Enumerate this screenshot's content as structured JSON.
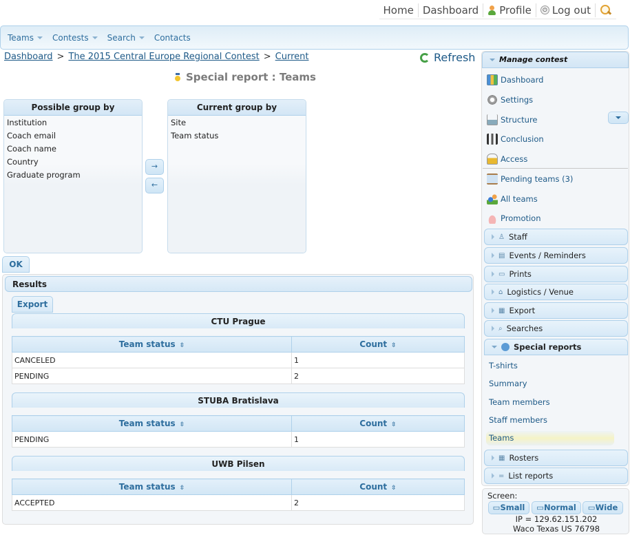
{
  "topbar": {
    "home": "Home",
    "dashboard": "Dashboard",
    "profile": "Profile",
    "logout": "Log out",
    "icons": [
      "user-icon",
      "power-icon",
      "search-icon"
    ]
  },
  "menu": [
    {
      "label": "Teams",
      "has_dropdown": true
    },
    {
      "label": "Contests",
      "has_dropdown": true
    },
    {
      "label": "Search",
      "has_dropdown": true
    },
    {
      "label": "Contacts",
      "has_dropdown": false
    }
  ],
  "breadcrumb": {
    "items": [
      "Dashboard",
      "The 2015 Central Europe Regional Contest",
      "Current"
    ],
    "separator": ">"
  },
  "refresh": "Refresh",
  "page_title": "Special report : Teams",
  "group_by": {
    "possible_title": "Possible group by",
    "possible": [
      "Institution",
      "Coach email",
      "Coach name",
      "Country",
      "Graduate program"
    ],
    "current_title": "Current group by",
    "current": [
      "Site",
      "Team status"
    ],
    "move_right": "→",
    "move_left": "←",
    "ok": "OK"
  },
  "results": {
    "title": "Results",
    "export": "Export",
    "col_status": "Team status",
    "col_count": "Count",
    "sort_glyph": "⇳",
    "groups": [
      {
        "name": "CTU Prague",
        "rows": [
          {
            "status": "CANCELED",
            "count": "1"
          },
          {
            "status": "PENDING",
            "count": "2"
          }
        ]
      },
      {
        "name": "STUBA Bratislava",
        "rows": [
          {
            "status": "PENDING",
            "count": "1"
          }
        ]
      },
      {
        "name": "UWB Pilsen",
        "rows": [
          {
            "status": "ACCEPTED",
            "count": "2"
          }
        ]
      }
    ]
  },
  "sidebar": {
    "title": "Manage contest",
    "items": [
      {
        "label": "Dashboard",
        "icon": "dashboard-icon"
      },
      {
        "label": "Settings",
        "icon": "gear-icon"
      },
      {
        "label": "Structure",
        "icon": "structure-icon"
      },
      {
        "label": "Conclusion",
        "icon": "conclusion-icon"
      },
      {
        "label": "Access",
        "icon": "lock-icon"
      },
      {
        "label": "Pending teams (3)",
        "icon": "hourglass-icon"
      },
      {
        "label": "All teams",
        "icon": "users-icon"
      },
      {
        "label": "Promotion",
        "icon": "thumbs-up-icon"
      }
    ],
    "sections": [
      {
        "label": "Staff",
        "icon": "staff-icon",
        "glyph": "♙"
      },
      {
        "label": "Events / Reminders",
        "icon": "comment-icon",
        "glyph": "▤"
      },
      {
        "label": "Prints",
        "icon": "print-icon",
        "glyph": "▭"
      },
      {
        "label": "Logistics / Venue",
        "icon": "venue-icon",
        "glyph": "⌂"
      },
      {
        "label": "Export",
        "icon": "export-icon",
        "glyph": "▦"
      },
      {
        "label": "Searches",
        "icon": "search-icon",
        "glyph": "⌕"
      }
    ],
    "special_reports": {
      "label": "Special reports",
      "items": [
        "T-shirts",
        "Summary",
        "Team members",
        "Staff members",
        "Teams"
      ],
      "selected": "Teams"
    },
    "bottom_sections": [
      {
        "label": "Rosters",
        "icon": "calendar-icon",
        "glyph": "▦"
      },
      {
        "label": "List reports",
        "icon": "list-icon",
        "glyph": "="
      }
    ]
  },
  "screen": {
    "label": "Screen:",
    "buttons": [
      "Small",
      "Normal",
      "Wide"
    ],
    "ip": "IP = 129.62.151.202",
    "location": "Waco Texas US 76798"
  },
  "colors": {
    "link": "#1d5987",
    "header_blue": "#2e6e9e",
    "border_blue": "#aed0ea",
    "highlight": "#f5f3c6"
  }
}
